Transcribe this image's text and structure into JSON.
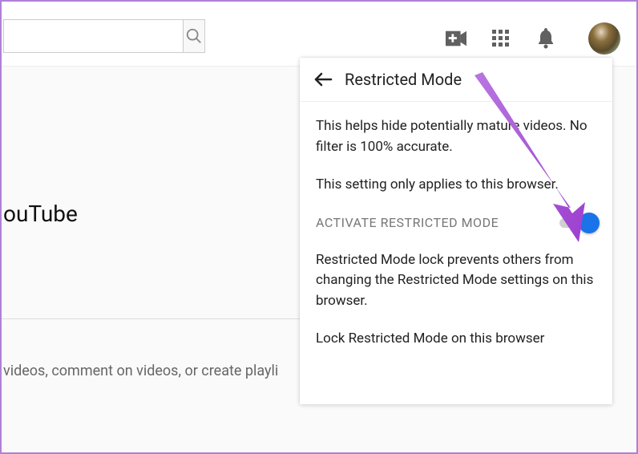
{
  "header": {
    "search_value": "",
    "search_placeholder": ""
  },
  "background": {
    "heading_fragment": "ouTube",
    "subtext_fragment": "videos, comment on videos, or create playli"
  },
  "panel": {
    "title": "Restricted Mode",
    "desc1": "This helps hide potentially mature videos. No filter is 100% accurate.",
    "desc2": "This setting only applies to this browser.",
    "toggle_label": "ACTIVATE RESTRICTED MODE",
    "toggle_on": true,
    "lock_desc": "Restricted Mode lock prevents others from changing the Restricted Mode settings on this browser.",
    "lock_action": "Lock Restricted Mode on this browser"
  },
  "annotation": {
    "arrow_color": "#a84fd8"
  }
}
